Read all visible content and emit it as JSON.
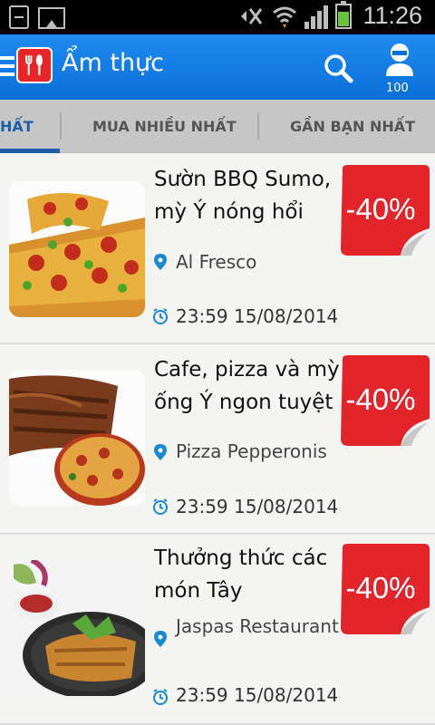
{
  "status_bar": {
    "time": "11:26",
    "icons": [
      "sim-card-icon",
      "gallery-icon",
      "mute-icon",
      "wifi-icon",
      "signal-icon",
      "battery-icon"
    ]
  },
  "app_bar": {
    "title": "Ẩm thực",
    "points": "100",
    "icons": [
      "menu-icon",
      "cutlery-logo-icon",
      "search-icon",
      "profile-icon"
    ]
  },
  "tabs": [
    {
      "label": "HẤT",
      "active": true
    },
    {
      "label": "MUA NHIỀU NHẤT",
      "active": false
    },
    {
      "label": "GẦN BẠN NHẤT",
      "active": false
    }
  ],
  "deals": [
    {
      "title_line1": "Sườn BBQ Sumo,",
      "title_line2": "mỳ Ý nóng hổi",
      "venue": "Al Fresco",
      "expiry": "23:59 15/08/2014",
      "discount": "-40%"
    },
    {
      "title_line1": "Cafe, pizza và mỳ",
      "title_line2": "ống Ý ngon tuyệt",
      "venue": "Pizza Pepperonis",
      "expiry": "23:59 15/08/2014",
      "discount": "-40%"
    },
    {
      "title_line1": "Thưởng thức các",
      "title_line2": "món Tây",
      "venue": "Jaspas Restaurant",
      "expiry": "23:59 15/08/2014",
      "discount": "-40%"
    }
  ],
  "colors": {
    "app_bar": "#0a6fd8",
    "tab_active": "#1a5fa8",
    "discount_badge": "#e1252b"
  }
}
